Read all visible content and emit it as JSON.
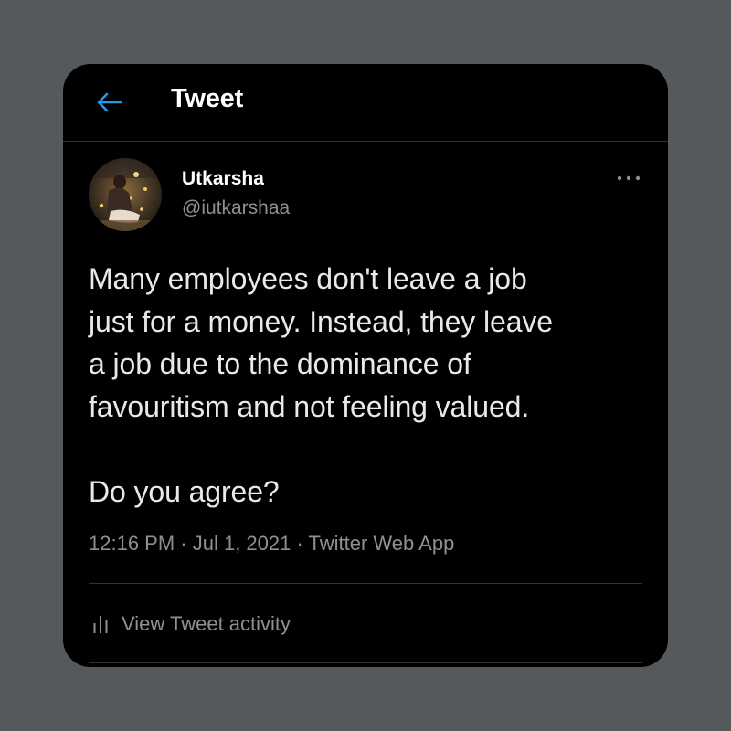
{
  "header": {
    "title": "Tweet",
    "back_icon": "arrow-left-icon"
  },
  "author": {
    "display_name": "Utkarsha",
    "handle": "@iutkarshaa",
    "avatar_icon": "profile-photo"
  },
  "tweet": {
    "text": "Many employees don't leave a job\njust for a money. Instead, they leave\na job due to the dominance of\nfavouritism and not feeling valued.\n\nDo you agree?",
    "time": "12:16 PM",
    "separator": " · ",
    "date": "Jul 1, 2021",
    "source": "Twitter Web App"
  },
  "activity": {
    "label": "View Tweet activity",
    "icon": "analytics-bars-icon"
  },
  "colors": {
    "page_background": "#55595c",
    "card_background": "#000000",
    "accent": "#1d9bf0",
    "primary_text": "#e7e9ea",
    "secondary_text": "#8b9196",
    "divider": "#2f3336"
  }
}
